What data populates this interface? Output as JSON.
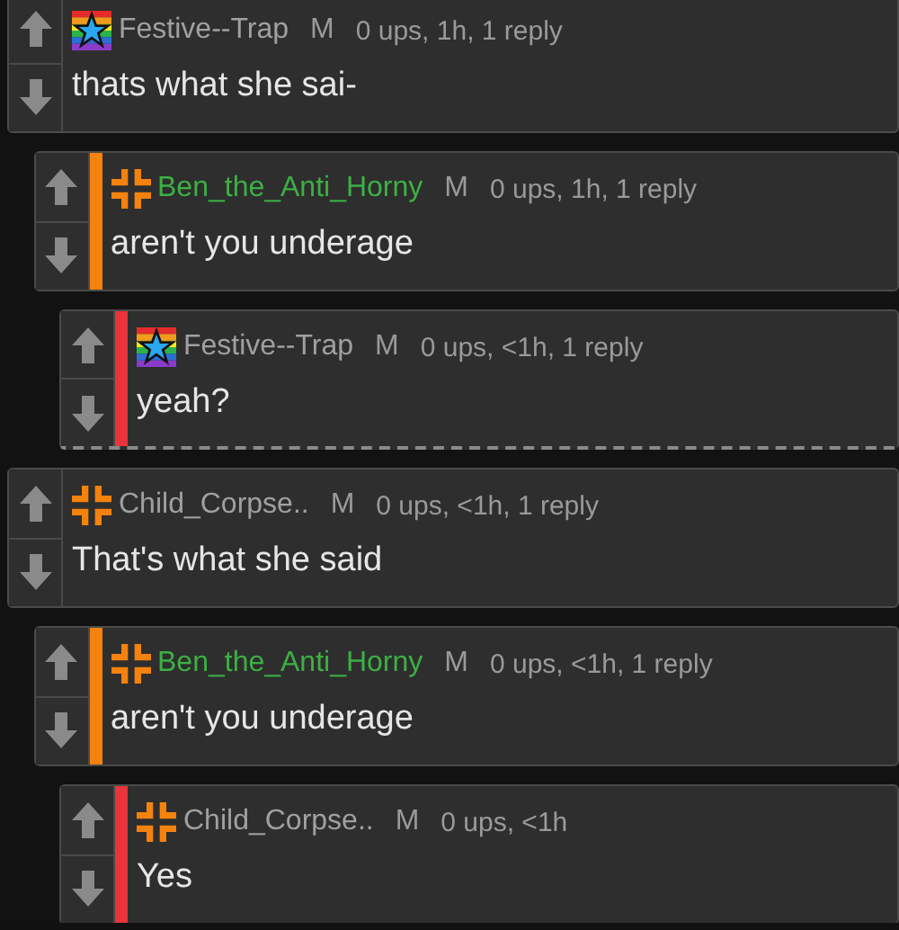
{
  "comments": [
    {
      "kind": "star",
      "username": "Festive--Trap",
      "color": "#a0a0a0",
      "badge": "M",
      "meta": "0 ups, 1h, 1 reply",
      "text": "thats what she sai-",
      "collapsed": false,
      "children": [
        {
          "kind": "cross",
          "username": "Ben_the_Anti_Horny",
          "color": "#3cb043",
          "badge": "M",
          "meta": "0 ups, 1h, 1 reply",
          "text": "aren't you underage",
          "collapsed": false,
          "children": [
            {
              "kind": "star",
              "username": "Festive--Trap",
              "color": "#a0a0a0",
              "badge": "M",
              "meta": "0 ups, <1h, 1 reply",
              "text": "yeah?",
              "collapsed": true
            }
          ]
        }
      ]
    },
    {
      "kind": "cross",
      "username": "Child_Corpse..",
      "color": "#a0a0a0",
      "badge": "M",
      "meta": "0 ups, <1h, 1 reply",
      "text": "That's what she said",
      "collapsed": false,
      "children": [
        {
          "kind": "cross",
          "username": "Ben_the_Anti_Horny",
          "color": "#3cb043",
          "badge": "M",
          "meta": "0 ups, <1h, 1 reply",
          "text": "aren't you underage",
          "collapsed": false,
          "children": [
            {
              "kind": "cross",
              "username": "Child_Corpse..",
              "color": "#a0a0a0",
              "badge": "M",
              "meta": "0 ups, <1h",
              "text": "Yes",
              "collapsed": false
            }
          ]
        }
      ]
    }
  ]
}
